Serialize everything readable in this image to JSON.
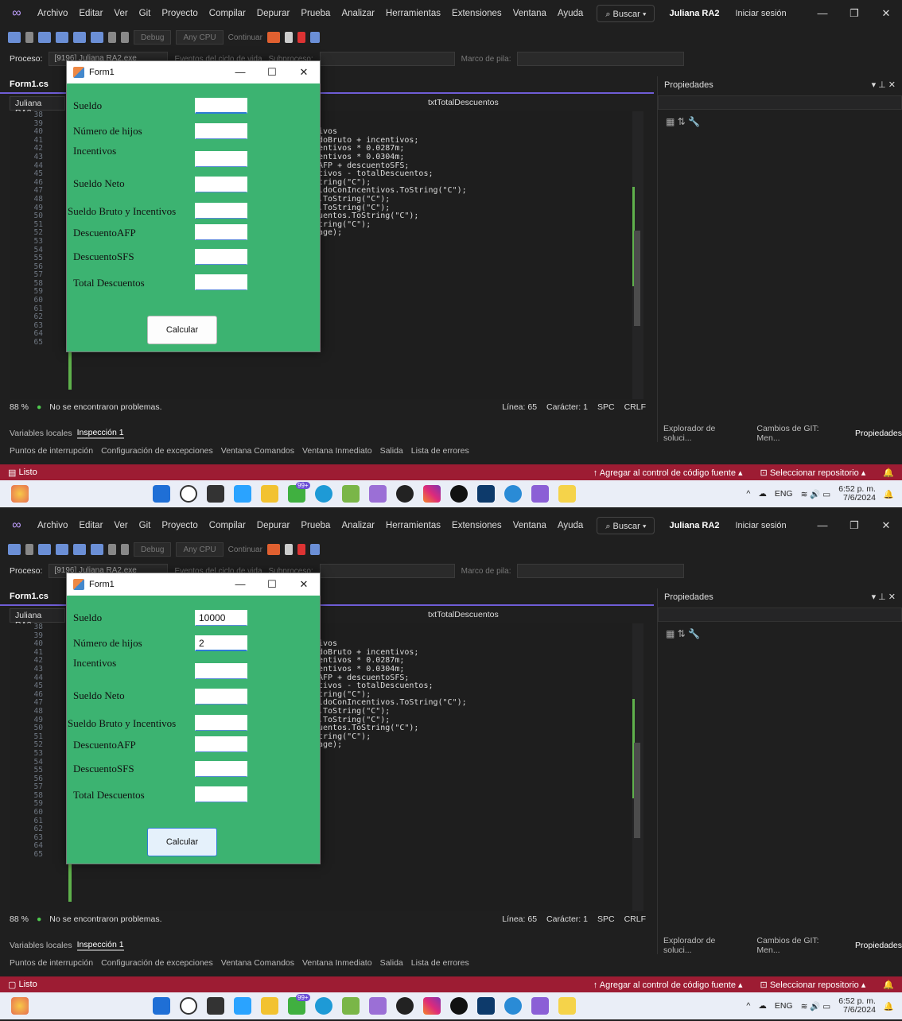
{
  "menu": {
    "items": [
      "Archivo",
      "Editar",
      "Ver",
      "Git",
      "Proyecto",
      "Compilar",
      "Depurar",
      "Prueba",
      "Analizar",
      "Herramientas",
      "Extensiones",
      "Ventana",
      "Ayuda"
    ],
    "search": "Buscar",
    "profile": "Juliana RA2",
    "signin": "Iniciar sesión"
  },
  "toolbar": {
    "config": "Debug",
    "platform": "Any CPU",
    "run": "Continuar",
    "process_label": "Proceso:",
    "process_value": "[9196] Juliana RA2.exe",
    "events": "Eventos del ciclo de vida",
    "thread": "Subproceso:",
    "stack": "Marco de pila:"
  },
  "editor": {
    "tab": "Form1.cs",
    "project": "Juliana RA2",
    "member": "txtTotalDescuentos",
    "line_numbers": [
      "38",
      "39",
      "40",
      "41",
      "42",
      "43",
      "44",
      "45",
      "46",
      "47",
      "48",
      "49",
      "50",
      "51",
      "52",
      "53",
      "54",
      "55",
      "56",
      "57",
      "58",
      "59",
      "60",
      "61",
      "62",
      "63",
      "64",
      "65"
    ],
    "code_lines": [
      "ivos",
      "doBruto + incentivos;",
      "",
      "",
      "entivos * 0.0287m;",
      "entivos * 0.0304m;",
      "AFP + descuentoSFS;",
      "",
      "",
      "tivos - totalDescuentos;",
      "",
      "",
      "tring(\"C\");",
      "ldoConIncentivos.ToString(\"C\");",
      ".ToString(\"C\");",
      ".ToString(\"C\");",
      "uentos.ToString(\"C\");",
      "tring(\"C\");",
      "",
      "",
      "",
      "age);",
      "",
      "",
      "",
      "",
      "",
      ""
    ]
  },
  "status": {
    "zoom": "88 %",
    "problems": "No se encontraron problemas.",
    "line": "Línea: 65",
    "char": "Carácter: 1",
    "spc": "SPC",
    "crlf": "CRLF"
  },
  "bottom": {
    "tabs": [
      "Variables locales",
      "Inspección 1"
    ],
    "tabs2": [
      "Puntos de interrupción",
      "Configuración de excepciones",
      "Ventana Comandos",
      "Ventana Inmediato",
      "Salida",
      "Lista de errores"
    ],
    "right_tabs": [
      "Explorador de soluci...",
      "Cambios de GIT: Men...",
      "Propiedades"
    ]
  },
  "props": {
    "title": "Propiedades"
  },
  "statusbar": {
    "ready": "Listo",
    "source_control": "Agregar al control de código fuente",
    "repo": "Seleccionar repositorio"
  },
  "taskbar": {
    "lang": "ENG",
    "time": "6:52 p. m.",
    "date": "7/6/2024",
    "badge": "99+"
  },
  "form": {
    "title": "Form1",
    "labels": {
      "sueldo": "Sueldo",
      "hijos": "Número de hijos",
      "incentivos": "Incentivos",
      "neto": "Sueldo Neto",
      "bruto": "Sueldo Bruto y  Incentivos",
      "afp": "DescuentoAFP",
      "sfs": "DescuentoSFS",
      "total": "Total Descuentos"
    },
    "button": "Calcular"
  },
  "shot1": {
    "sueldo_value": "",
    "hijos_value": ""
  },
  "shot2": {
    "sueldo_value": "10000",
    "hijos_value": "2"
  }
}
